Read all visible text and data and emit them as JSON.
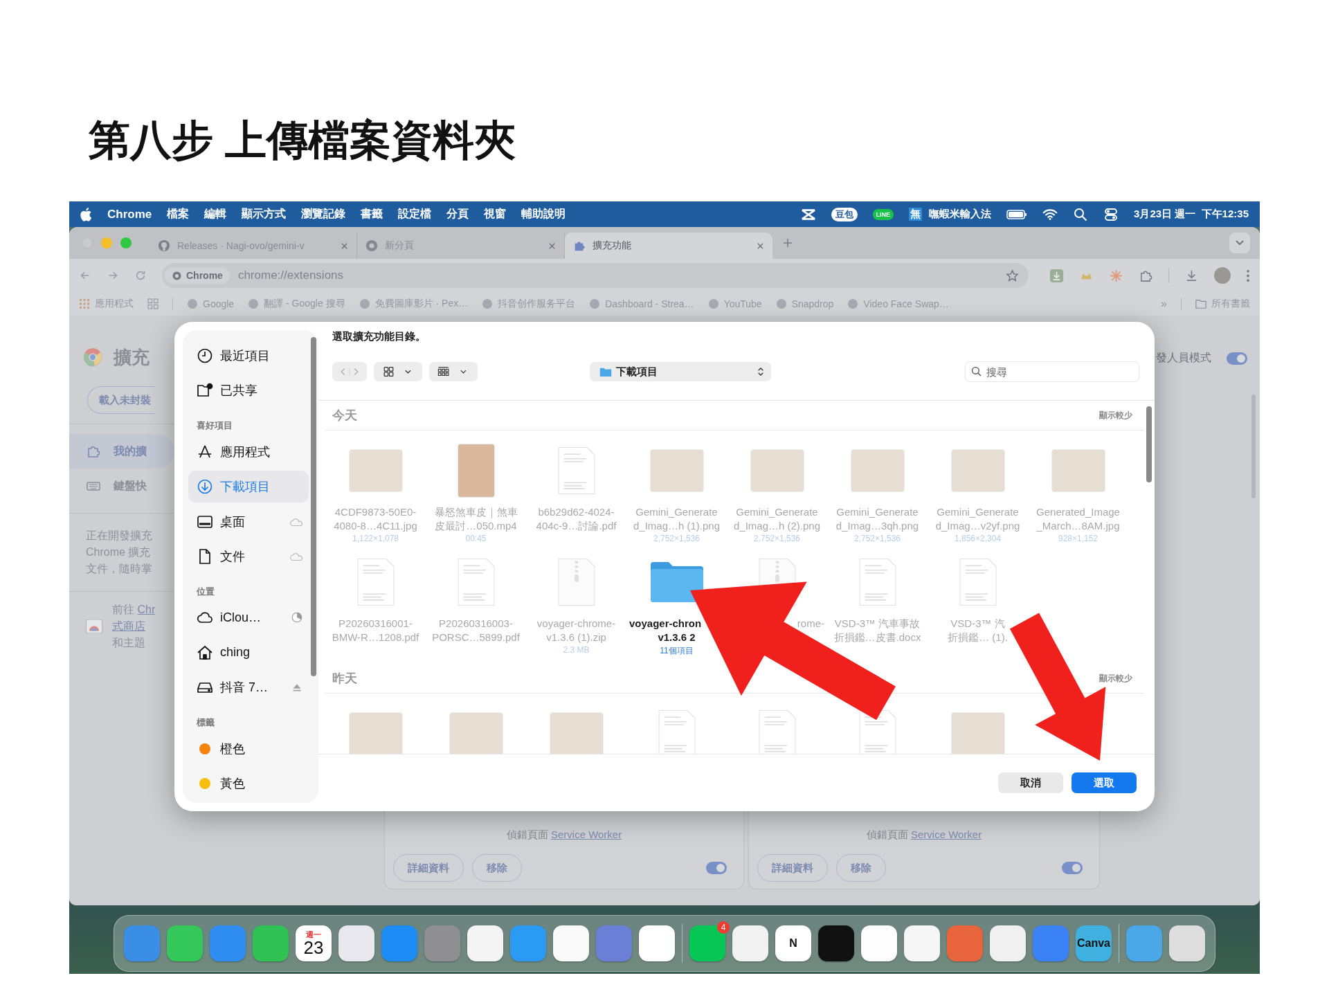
{
  "slide_title": "第八步 上傳檔案資料夾",
  "menu_bar": {
    "app": "Chrome",
    "menus": [
      "檔案",
      "編輯",
      "顯示方式",
      "瀏覽記錄",
      "書籤",
      "設定檔",
      "分頁",
      "視窗",
      "輔助說明"
    ],
    "status_items": [
      {
        "kind": "capcut"
      },
      {
        "kind": "bubble",
        "text": "豆包"
      },
      {
        "kind": "line",
        "text": "LINE"
      },
      {
        "kind": "ime",
        "text": "無"
      },
      {
        "kind": "label",
        "text": "嘸蝦米輸入法"
      },
      {
        "kind": "battery"
      },
      {
        "kind": "wifi"
      },
      {
        "kind": "search"
      },
      {
        "kind": "control"
      },
      {
        "kind": "label",
        "text": "3月23日 週一  下午12:35"
      }
    ]
  },
  "tabs": [
    {
      "title": "Releases · Nagi-ovo/gemini-v",
      "selected": false
    },
    {
      "title": "新分頁",
      "selected": false
    },
    {
      "title": "擴充功能",
      "selected": true
    }
  ],
  "address_bar": {
    "chip": "Chrome",
    "url": "chrome://extensions"
  },
  "bookmarks": {
    "apps": "應用程式",
    "items": [
      "Google",
      "翻譯 - Google 搜尋",
      "免費圖庫影片 · Pex…",
      "抖音创作服务平台",
      "Dashboard - Strea…",
      "YouTube",
      "Snapdrop",
      "Video Face Swap…"
    ],
    "more": "»",
    "all": "所有書籤"
  },
  "extensions_page": {
    "title": "擴充",
    "load_button": "載入未封裝",
    "dev_mode": {
      "label": "發人員模式",
      "on": true
    },
    "nav": [
      {
        "label": "我的擴",
        "selected": true
      },
      {
        "label": "鍵盤快",
        "selected": false
      }
    ],
    "info_lines": [
      "正在開發擴充",
      "Chrome 擴充",
      "文件，隨時掌"
    ],
    "store_lines": [
      [
        {
          "kind": "text",
          "text": "前往 "
        },
        {
          "kind": "link",
          "text": "Chr"
        }
      ],
      [
        {
          "kind": "link",
          "text": "式商店"
        }
      ],
      [
        {
          "kind": "text",
          "text": "和主題"
        }
      ]
    ],
    "cards": [
      {
        "debug_label": "偵錯頁面",
        "debug_link": "Service Worker",
        "buttons": [
          "詳細資料",
          "移除"
        ],
        "on": true
      },
      {
        "debug_label": "偵錯頁面",
        "debug_link": "Service Worker",
        "buttons": [
          "詳細資料",
          "移除"
        ],
        "on": true
      }
    ]
  },
  "dialog": {
    "message": "選取擴充功能目錄。",
    "location": "下載項目",
    "search_placeholder": "搜尋",
    "sidebar": [
      {
        "kind": "clock",
        "label": "最近項目",
        "selected": false
      },
      {
        "kind": "shared",
        "label": "已共享",
        "selected": false
      },
      {
        "kind": "heading",
        "label": "喜好項目"
      },
      {
        "kind": "apps",
        "label": "應用程式",
        "selected": false
      },
      {
        "kind": "download",
        "label": "下載項目",
        "selected": true
      },
      {
        "kind": "desktop",
        "label": "桌面",
        "selected": false
      },
      {
        "kind": "document",
        "label": "文件",
        "selected": false
      },
      {
        "kind": "heading",
        "label": "位置"
      },
      {
        "kind": "cloud",
        "label": "iClou…",
        "selected": false
      },
      {
        "kind": "home",
        "label": "ching",
        "selected": false
      },
      {
        "kind": "drive",
        "label": "抖音 7…",
        "selected": false
      },
      {
        "kind": "heading",
        "label": "標籤"
      },
      {
        "kind": "tag",
        "label": "橙色",
        "color": "#f5820d",
        "selected": false
      },
      {
        "kind": "tag",
        "label": "黃色",
        "color": "#f7be0c",
        "selected": false
      }
    ],
    "sections": [
      {
        "title": "今天",
        "toggle": "顯示較少",
        "files": [
          {
            "kind": "image",
            "name": [
              "4CDF9873-50E0-",
              "4080-8…4C11.jpg"
            ],
            "meta": "1,122×1,078",
            "disabled": true
          },
          {
            "kind": "video",
            "name": [
              "暴怒煞車皮｜煞車",
              "皮最討…050.mp4"
            ],
            "meta": "00:45",
            "disabled": true
          },
          {
            "kind": "pdf",
            "name": [
              "b6b29d62-4024-",
              "404c-9…討論.pdf"
            ],
            "disabled": true
          },
          {
            "kind": "image",
            "name": [
              "Gemini_Generate",
              "d_Imag…h (1).png"
            ],
            "meta": "2,752×1,536",
            "disabled": true
          },
          {
            "kind": "image",
            "name": [
              "Gemini_Generate",
              "d_Imag…h (2).png"
            ],
            "meta": "2,752×1,536",
            "disabled": true
          },
          {
            "kind": "image",
            "name": [
              "Gemini_Generate",
              "d_Imag…3qh.png"
            ],
            "meta": "2,752×1,536",
            "disabled": true
          },
          {
            "kind": "image",
            "name": [
              "Gemini_Generate",
              "d_Imag…v2yf.png"
            ],
            "meta": "1,856×2,304",
            "disabled": true
          },
          {
            "kind": "image",
            "name": [
              "Generated_Image",
              "_March…8AM.jpg"
            ],
            "meta": "928×1,152",
            "disabled": true
          },
          {
            "kind": "pdf",
            "name": [
              "P20260316001-",
              "BMW-R…1208.pdf"
            ],
            "disabled": true
          },
          {
            "kind": "pdf",
            "name": [
              "P20260316003-",
              "PORSC…5899.pdf"
            ],
            "disabled": true
          },
          {
            "kind": "zip",
            "name": [
              "voyager-chrome-",
              "v1.3.6 (1).zip"
            ],
            "meta": "2.3 MB",
            "disabled": true
          },
          {
            "kind": "folder",
            "name": [
              "voyager-chron",
              "v1.3.6 2"
            ],
            "meta": "11個項目",
            "disabled": false
          },
          {
            "kind": "zip",
            "name": [
              "rome-"
            ],
            "disabled": true
          },
          {
            "kind": "pdf",
            "name": [
              "VSD-3™ 汽車事故",
              "折損鑑…皮書.docx"
            ],
            "disabled": true
          },
          {
            "kind": "pdf",
            "name": [
              "VSD-3™ 汽",
              "折損鑑… (1)."
            ],
            "disabled": true
          }
        ]
      },
      {
        "title": "昨天",
        "toggle": "顯示較少",
        "files": [
          {
            "kind": "image"
          },
          {
            "kind": "image"
          },
          {
            "kind": "image"
          },
          {
            "kind": "pdf"
          },
          {
            "kind": "pdf"
          },
          {
            "kind": "pdf"
          },
          {
            "kind": "image"
          }
        ]
      }
    ],
    "buttons": [
      {
        "kind": "secondary",
        "label": "取消"
      },
      {
        "kind": "primary",
        "label": "選取"
      }
    ]
  },
  "dock": {
    "items": [
      {
        "kind": "app",
        "color": "#3a8ee6"
      },
      {
        "kind": "app",
        "color": "#34c759"
      },
      {
        "kind": "app",
        "color": "#2f8cf0"
      },
      {
        "kind": "app",
        "color": "#30c255"
      },
      {
        "kind": "app",
        "color": "#ffffff",
        "top": "週一",
        "text": "23"
      },
      {
        "kind": "app",
        "color": "#e8e8ee"
      },
      {
        "kind": "app",
        "color": "#1e8cf5"
      },
      {
        "kind": "app",
        "color": "#8e8e93"
      },
      {
        "kind": "app",
        "color": "#f4f4f4"
      },
      {
        "kind": "app",
        "color": "#2b9af3"
      },
      {
        "kind": "app",
        "color": "#fafafa"
      },
      {
        "kind": "app",
        "color": "#6a7fd6"
      },
      {
        "kind": "app",
        "color": "#ffffff"
      },
      {
        "kind": "separator"
      },
      {
        "kind": "app",
        "color": "#06c755",
        "badge": "4"
      },
      {
        "kind": "app",
        "color": "#f2f2f2"
      },
      {
        "kind": "app",
        "color": "#ffffff",
        "text": "N"
      },
      {
        "kind": "app",
        "color": "#111111"
      },
      {
        "kind": "app",
        "color": "#fdfdfd"
      },
      {
        "kind": "app",
        "color": "#f6f6f6"
      },
      {
        "kind": "app",
        "color": "#e8643c"
      },
      {
        "kind": "app",
        "color": "#f0f0f0"
      },
      {
        "kind": "app",
        "color": "#3b82f6"
      },
      {
        "kind": "app",
        "color": "#3fb0e0",
        "text": "Canva"
      },
      {
        "kind": "separator"
      },
      {
        "kind": "app",
        "color": "#4aa8e8"
      },
      {
        "kind": "app",
        "color": "#dedede"
      }
    ]
  }
}
